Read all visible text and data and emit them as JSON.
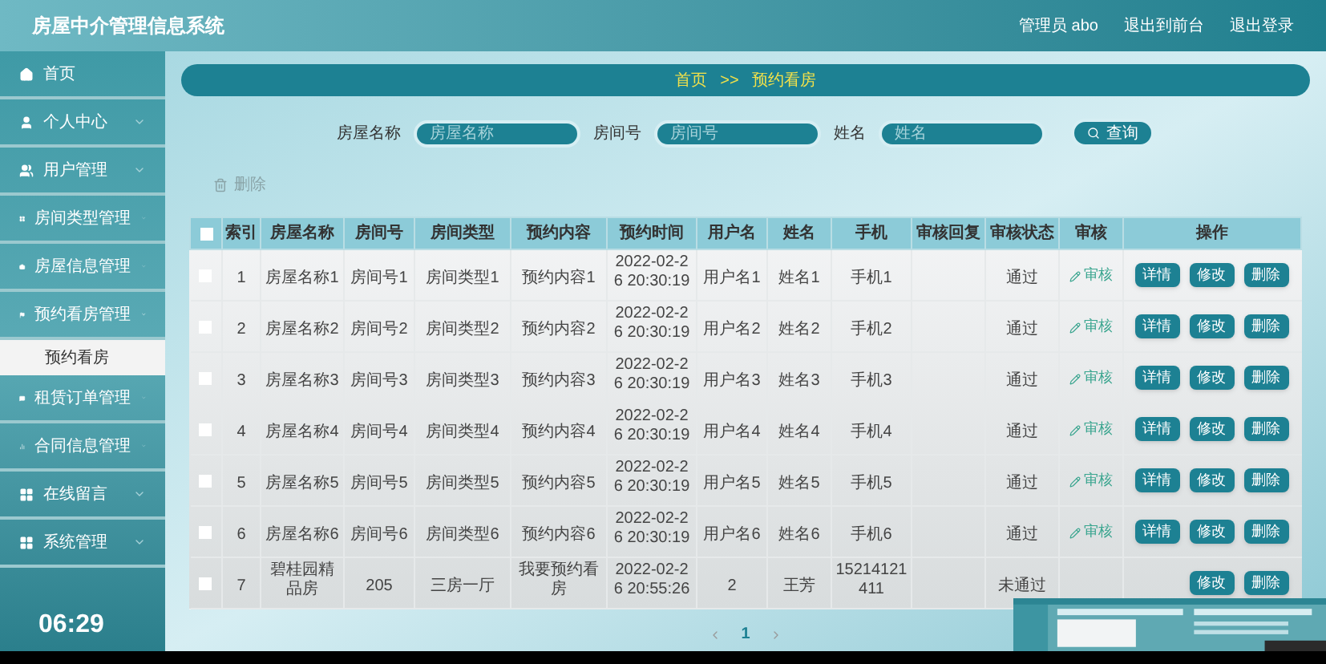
{
  "header": {
    "title": "房屋中介管理信息系统",
    "links": [
      "管理员 abo",
      "退出到前台",
      "退出登录"
    ]
  },
  "sidebar": {
    "items": [
      {
        "label": "首页"
      },
      {
        "label": "个人中心",
        "expanded": false
      },
      {
        "label": "用户管理",
        "expanded": false
      },
      {
        "label": "房间类型管理",
        "expanded": false
      },
      {
        "label": "房屋信息管理",
        "expanded": false
      },
      {
        "label": "预约看房管理",
        "expanded": true,
        "children": [
          {
            "label": "预约看房",
            "selected": true
          }
        ]
      },
      {
        "label": "租赁订单管理",
        "expanded": false
      },
      {
        "label": "合同信息管理",
        "expanded": false
      },
      {
        "label": "在线留言",
        "expanded": false
      },
      {
        "label": "系统管理",
        "expanded": false
      }
    ]
  },
  "breadcrumb": [
    "首页",
    ">>",
    "预约看房"
  ],
  "search": {
    "fields": [
      {
        "label": "房屋名称",
        "placeholder": "房屋名称"
      },
      {
        "label": "房间号",
        "placeholder": "房间号"
      },
      {
        "label": "姓名",
        "placeholder": "姓名"
      }
    ],
    "button": "查询"
  },
  "delete_link": {
    "label": "删除",
    "disabled": true
  },
  "table": {
    "header_checked": false,
    "columns": [
      "索引",
      "房屋名称",
      "房间号",
      "房间类型",
      "预约内容",
      "预约时间",
      "用户名",
      "姓名",
      "手机",
      "审核回复",
      "审核状态",
      "审核",
      "操作"
    ],
    "rows": [
      {
        "checked": false,
        "cells": [
          "1",
          "房屋名称1",
          "房间号1",
          "房间类型1",
          "预约内容1",
          "2022-02-26 20:30:19",
          "用户名1",
          "姓名1",
          "手机1",
          "",
          "通过"
        ],
        "audit": "审核",
        "actions": [
          "详情",
          "修改",
          "删除"
        ]
      },
      {
        "checked": false,
        "cells": [
          "2",
          "房屋名称2",
          "房间号2",
          "房间类型2",
          "预约内容2",
          "2022-02-26 20:30:19",
          "用户名2",
          "姓名2",
          "手机2",
          "",
          "通过"
        ],
        "audit": "审核",
        "actions": [
          "详情",
          "修改",
          "删除"
        ]
      },
      {
        "checked": false,
        "cells": [
          "3",
          "房屋名称3",
          "房间号3",
          "房间类型3",
          "预约内容3",
          "2022-02-26 20:30:19",
          "用户名3",
          "姓名3",
          "手机3",
          "",
          "通过"
        ],
        "audit": "审核",
        "actions": [
          "详情",
          "修改",
          "删除"
        ]
      },
      {
        "checked": false,
        "cells": [
          "4",
          "房屋名称4",
          "房间号4",
          "房间类型4",
          "预约内容4",
          "2022-02-26 20:30:19",
          "用户名4",
          "姓名4",
          "手机4",
          "",
          "通过"
        ],
        "audit": "审核",
        "actions": [
          "详情",
          "修改",
          "删除"
        ]
      },
      {
        "checked": false,
        "cells": [
          "5",
          "房屋名称5",
          "房间号5",
          "房间类型5",
          "预约内容5",
          "2022-02-26 20:30:19",
          "用户名5",
          "姓名5",
          "手机5",
          "",
          "通过"
        ],
        "audit": "审核",
        "actions": [
          "详情",
          "修改",
          "删除"
        ]
      },
      {
        "checked": false,
        "cells": [
          "6",
          "房屋名称6",
          "房间号6",
          "房间类型6",
          "预约内容6",
          "2022-02-26 20:30:19",
          "用户名6",
          "姓名6",
          "手机6",
          "",
          "通过"
        ],
        "audit": "审核",
        "actions": [
          "详情",
          "修改",
          "删除"
        ]
      },
      {
        "checked": false,
        "cells": [
          "7",
          "碧桂园精品房",
          "205",
          "三房一厅",
          "我要预约看房",
          "2022-02-26 20:55:26",
          "2",
          "王芳",
          "15214121411",
          "",
          "未通过"
        ],
        "actions": [
          "修改",
          "删除"
        ]
      }
    ]
  },
  "pagination": {
    "pages": [
      {
        "label": "1",
        "selected": true
      }
    ]
  },
  "video": {
    "timestamp": "06:29"
  }
}
